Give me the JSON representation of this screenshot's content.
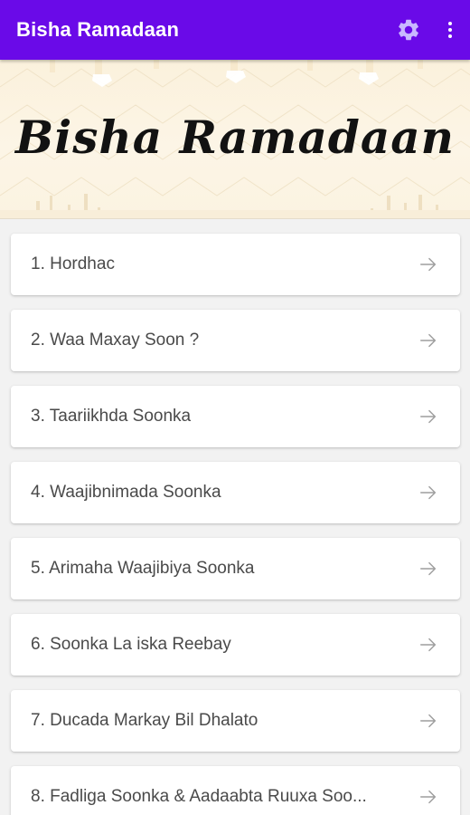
{
  "appbar": {
    "title": "Bisha Ramadaan",
    "icons": {
      "settings": "gear-icon",
      "overflow": "more-vertical-icon"
    },
    "color": "#6a0ae8"
  },
  "banner": {
    "title": "Bisha Ramadaan"
  },
  "items": [
    {
      "label": "1.  Hordhac"
    },
    {
      "label": "2.  Waa Maxay Soon ?"
    },
    {
      "label": "3.  Taariikhda Soonka"
    },
    {
      "label": "4.  Waajibnimada Soonka"
    },
    {
      "label": "5.  Arimaha Waajibiya Soonka"
    },
    {
      "label": "6.  Soonka La iska Reebay"
    },
    {
      "label": "7.  Ducada Markay Bil Dhalato"
    },
    {
      "label": "8.  Fadliga Soonka & Aadaabta Ruuxa Soo..."
    }
  ]
}
